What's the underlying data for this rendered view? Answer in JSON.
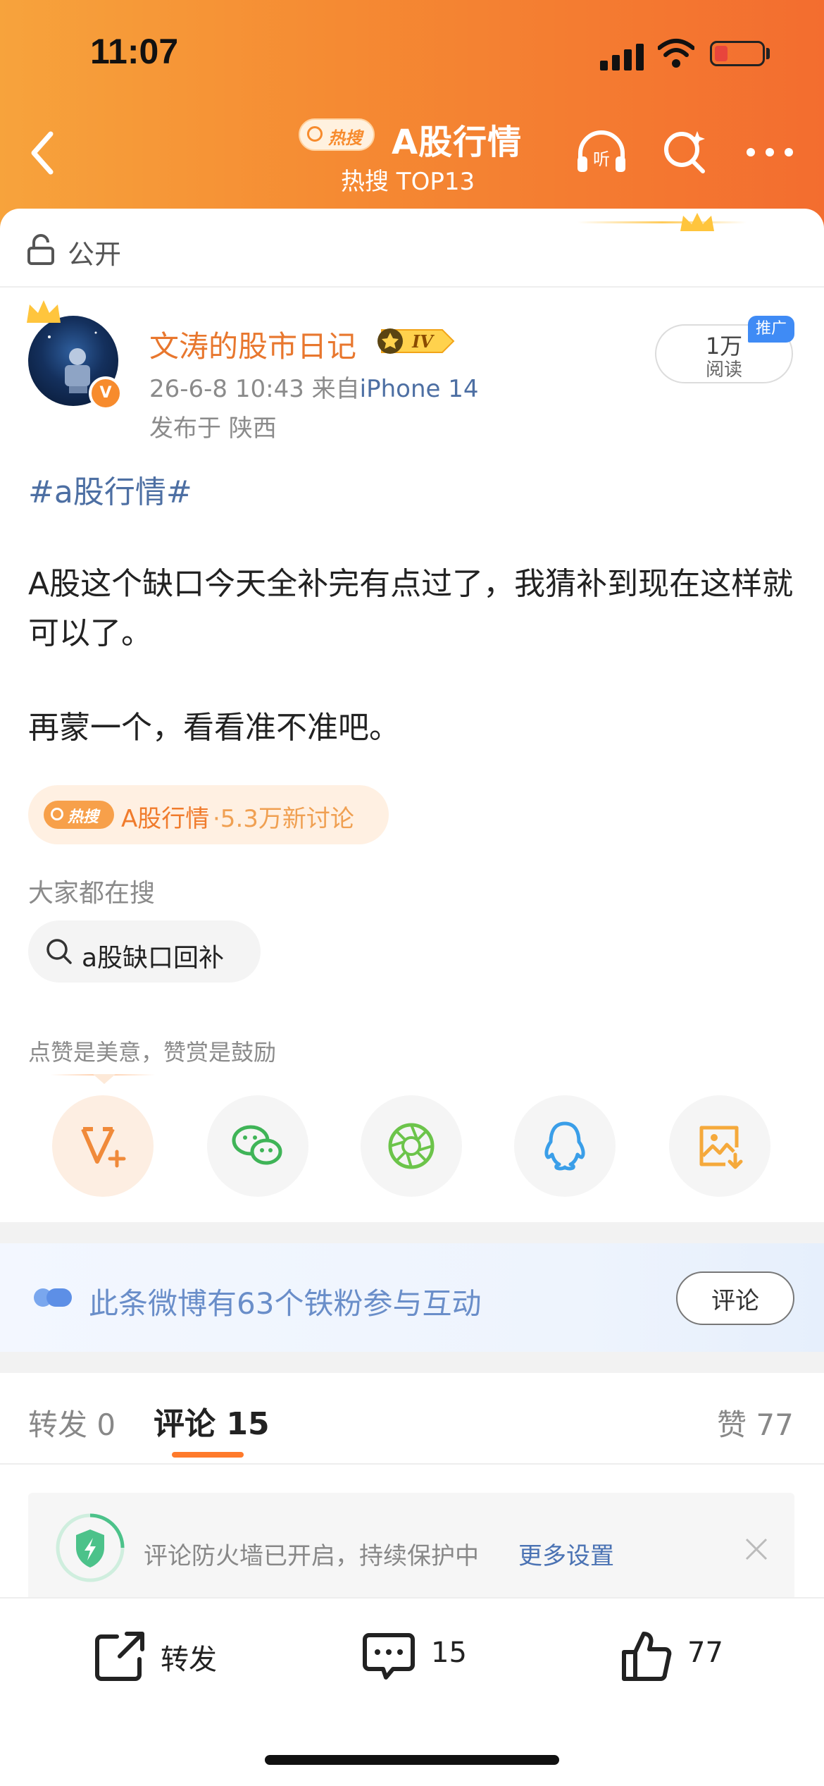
{
  "status_bar": {
    "time": "11:07"
  },
  "nav": {
    "hot_badge": "热搜",
    "topic_title": "A股行情",
    "topic_sub": "热搜 TOP13",
    "listen_label": "听"
  },
  "visibility": {
    "label": "公开"
  },
  "author": {
    "name": "文涛的股市日记",
    "level": "IV",
    "verified_badge": "V",
    "date": "26-6-8 10:43",
    "via": "来自",
    "device": "iPhone 14",
    "location": "发布于 陕西"
  },
  "reads": {
    "count": "1万",
    "label": "阅读",
    "promo": "推广"
  },
  "post": {
    "hashtag": "#a股行情#",
    "paragraph_1": "A股这个缺口今天全补完有点过了，我猜补到现在这样就可以了。",
    "paragraph_2": "再蒙一个，看看准不准吧。"
  },
  "hot_topic": {
    "badge": "热搜",
    "topic": "A股行情",
    "count": "·5.3万新讨论"
  },
  "related": {
    "label": "大家都在搜",
    "search_chip": "a股缺口回补"
  },
  "share": {
    "tip": "点赞是美意，赞赏是鼓励",
    "icons": [
      "weibo-reward-icon",
      "wechat-icon",
      "moments-icon",
      "qq-icon",
      "save-image-icon"
    ]
  },
  "fans_banner": {
    "text": "此条微博有63个铁粉参与互动",
    "button": "评论"
  },
  "tabs": {
    "repost": "转发 0",
    "comments_label": "评论",
    "comments_count": "15",
    "likes": "赞 77"
  },
  "firewall": {
    "text": "评论防火墙已开启，持续保护中",
    "link": "更多设置"
  },
  "bottom_bar": {
    "repost_label": "转发",
    "comment_count": "15",
    "like_count": "77"
  },
  "colors": {
    "header_start": "#f7a33c",
    "header_end": "#f36d2f",
    "accent": "#ff7a2b",
    "link": "#4d6fa3"
  }
}
